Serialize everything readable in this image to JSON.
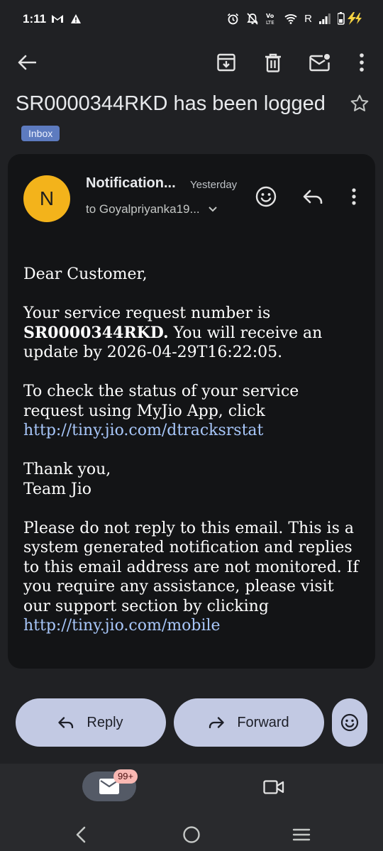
{
  "status_bar": {
    "time": "1:11",
    "carrier_label": "R",
    "icons": [
      "gmail-icon",
      "warning-icon",
      "alarm-icon",
      "mute-icon",
      "volte-icon",
      "wifi-icon",
      "signal-icon",
      "battery-charging-icon"
    ]
  },
  "toolbar": {
    "icons": [
      "back-arrow-icon",
      "archive-icon",
      "delete-icon",
      "mark-unread-icon",
      "more-vert-icon"
    ]
  },
  "email": {
    "subject": "SR0000344RKD has been logged",
    "label_chip": "Inbox",
    "sender": {
      "avatar_initial": "N",
      "name": "Notification...",
      "time": "Yesterday",
      "recipient": "to Goyalpriyanka19..."
    },
    "body": {
      "greeting": "Dear Customer,",
      "para1_prefix": "Your service request number is ",
      "sr_number": "SR0000344RKD.",
      "para1_suffix": " You will receive an update by 2026-04-29T16:22:05.",
      "para2_text": "To check the status of your service request using MyJio App, click ",
      "link1": "http://tiny.jio.com/dtracksrstat",
      "signoff_line1": "Thank you,",
      "signoff_line2": "Team Jio",
      "para3_text": "Please do not reply to this email. This is a system generated notification and replies to this email address are not monitored. If you require any assistance, please visit our support section by clicking ",
      "link2": "http://tiny.jio.com/mobile"
    }
  },
  "actions": {
    "reply_label": "Reply",
    "forward_label": "Forward"
  },
  "bottom_nav": {
    "mail_badge": "99+"
  },
  "colors": {
    "background": "#202124",
    "card": "#131416",
    "avatar": "#f3b31b",
    "link": "#a8c7fa",
    "pill": "#c2c9e3",
    "chip": "#5d7bbf"
  }
}
